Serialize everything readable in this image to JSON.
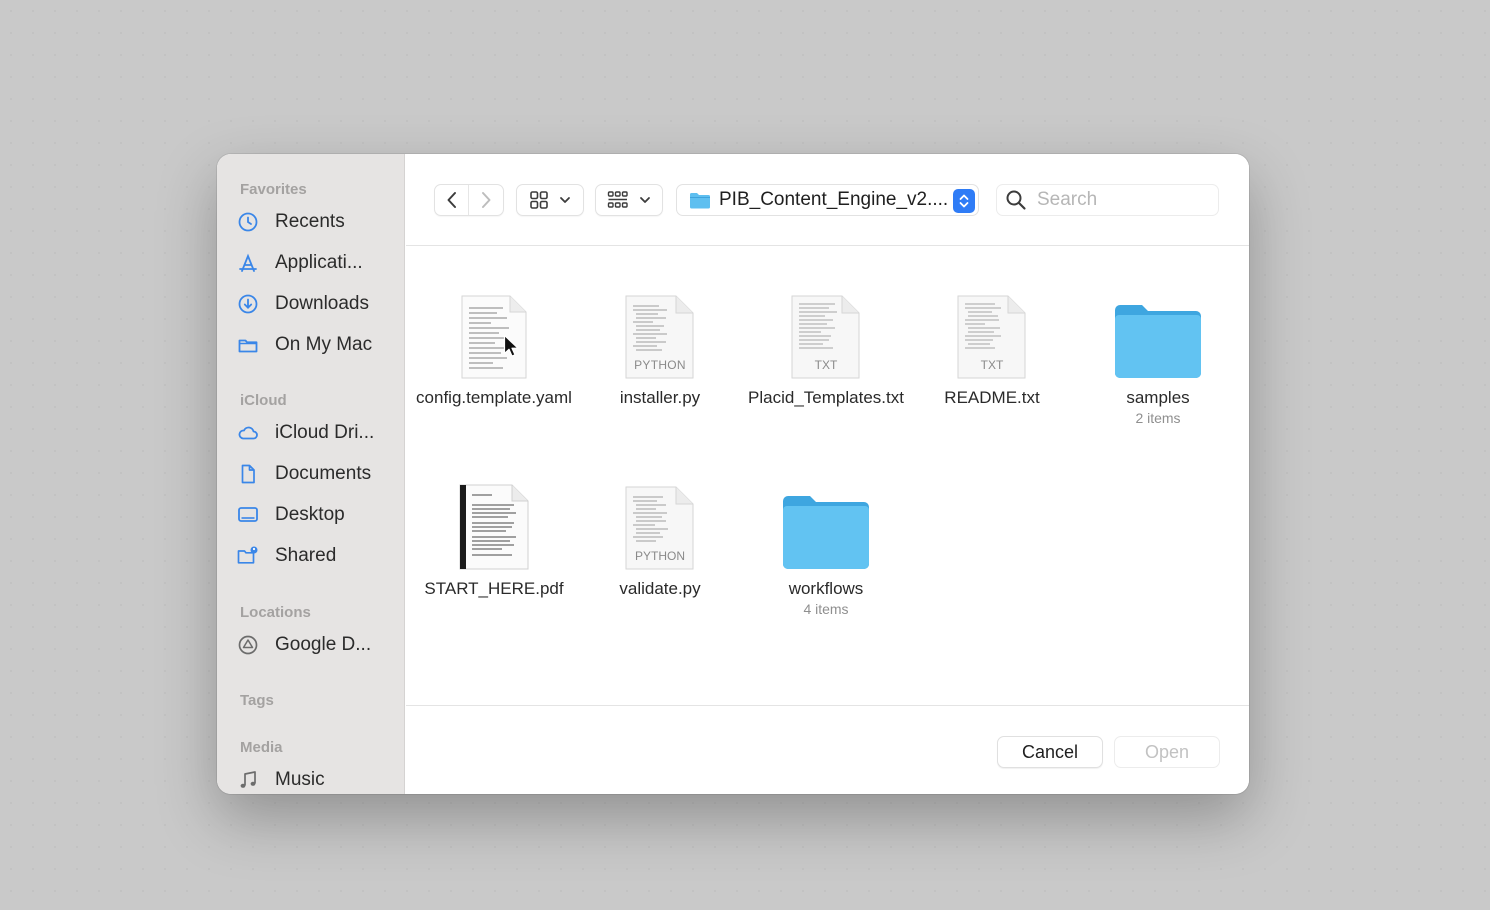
{
  "sidebar": {
    "sections": [
      {
        "label": "Favorites"
      },
      {
        "label": "iCloud"
      },
      {
        "label": "Locations"
      },
      {
        "label": "Tags"
      },
      {
        "label": "Media"
      }
    ],
    "items": [
      {
        "label": "Recents",
        "icon": "clock-icon"
      },
      {
        "label": "Applicati...",
        "icon": "applications-icon"
      },
      {
        "label": "Downloads",
        "icon": "download-icon"
      },
      {
        "label": "On My Mac",
        "icon": "folder-icon"
      },
      {
        "label": "iCloud Dri...",
        "icon": "cloud-icon"
      },
      {
        "label": "Documents",
        "icon": "document-icon"
      },
      {
        "label": "Desktop",
        "icon": "desktop-icon"
      },
      {
        "label": "Shared",
        "icon": "shared-folder-icon"
      },
      {
        "label": "Google D...",
        "icon": "google-drive-icon"
      },
      {
        "label": "Music",
        "icon": "music-note-icon"
      }
    ]
  },
  "toolbar": {
    "path_label": "PIB_Content_Engine_v2....",
    "search_placeholder": "Search"
  },
  "files": [
    {
      "name": "config.template.yaml",
      "kind": "document",
      "badge": ""
    },
    {
      "name": "installer.py",
      "kind": "document",
      "badge": "PYTHON"
    },
    {
      "name": "Placid_Templates.txt",
      "kind": "document",
      "badge": "TXT"
    },
    {
      "name": "README.txt",
      "kind": "document",
      "badge": "TXT"
    },
    {
      "name": "samples",
      "kind": "folder",
      "meta": "2 items"
    },
    {
      "name": "START_HERE.pdf",
      "kind": "pdf",
      "badge": ""
    },
    {
      "name": "validate.py",
      "kind": "document",
      "badge": "PYTHON"
    },
    {
      "name": "workflows",
      "kind": "folder",
      "meta": "4 items"
    }
  ],
  "footer": {
    "cancel_label": "Cancel",
    "open_label": "Open"
  },
  "colors": {
    "accent": "#2f7cf6",
    "folder": "#5ebff0",
    "sidebar_icon": "#3a86e8"
  }
}
